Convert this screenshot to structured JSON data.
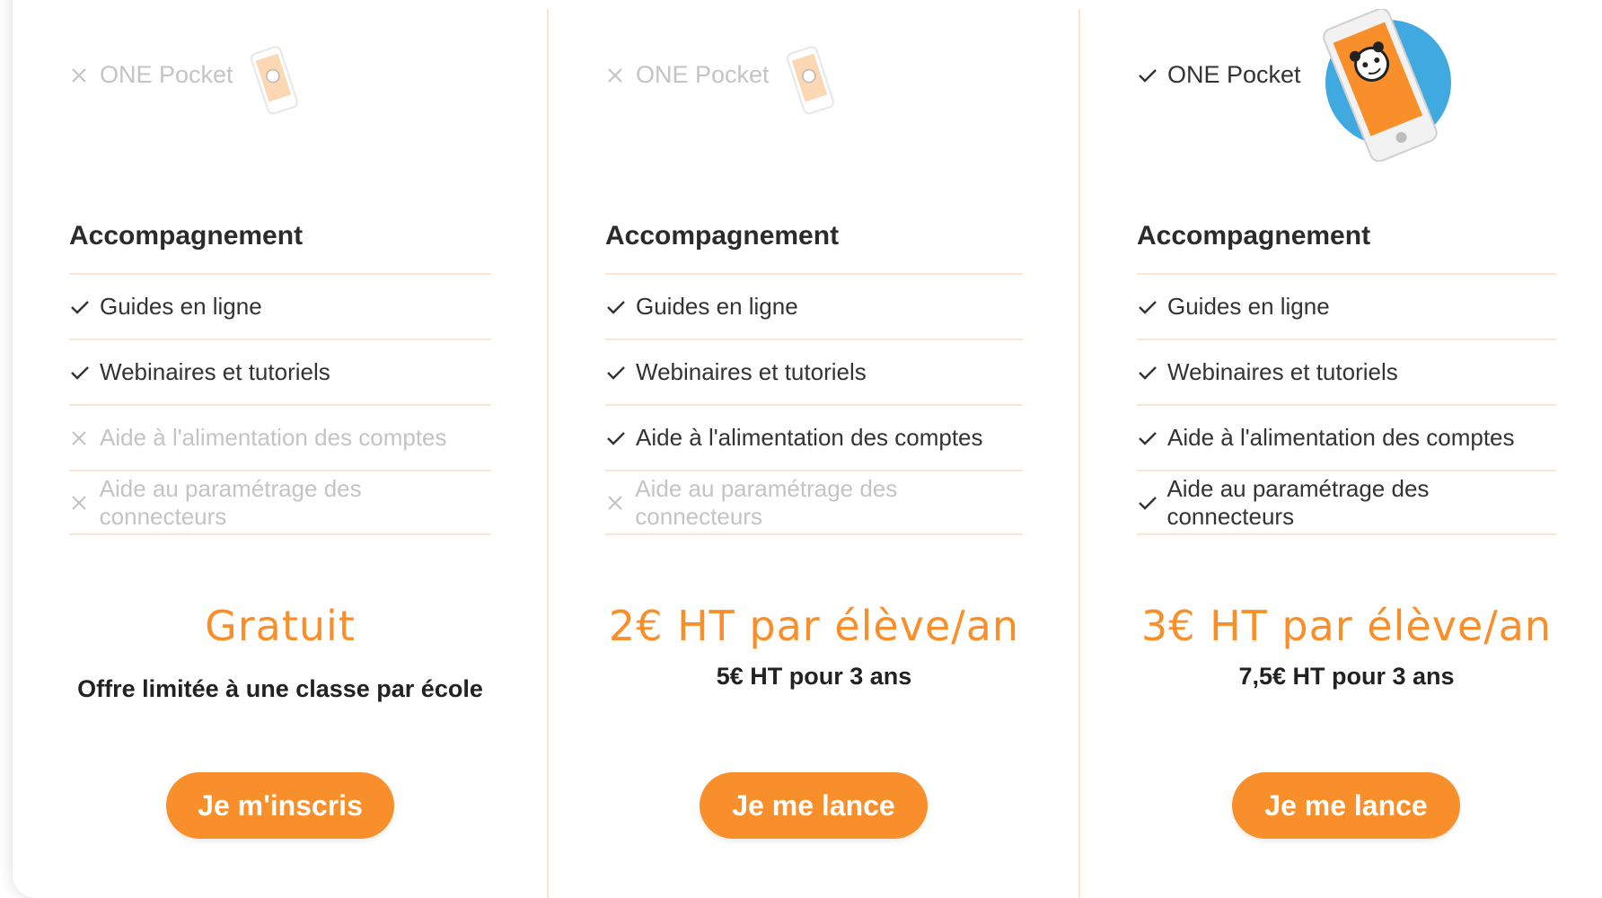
{
  "accent_color": "#f98f2a",
  "disabled_color": "#c4c4c4",
  "plans": [
    {
      "pocket": {
        "label": "ONE Pocket",
        "included": false
      },
      "section_title": "Accompagnement",
      "features": [
        {
          "label": "Guides en ligne",
          "included": true
        },
        {
          "label": "Webinaires et tutoriels",
          "included": true
        },
        {
          "label": "Aide à l'alimentation des comptes",
          "included": false
        },
        {
          "label": "Aide au paramétrage des connecteurs",
          "included": false
        }
      ],
      "price": "Gratuit",
      "price_note": "Offre limitée à une classe par école",
      "cta": "Je m'inscris"
    },
    {
      "pocket": {
        "label": "ONE Pocket",
        "included": false
      },
      "section_title": "Accompagnement",
      "features": [
        {
          "label": "Guides en ligne",
          "included": true
        },
        {
          "label": "Webinaires et tutoriels",
          "included": true
        },
        {
          "label": "Aide à l'alimentation des comptes",
          "included": true
        },
        {
          "label": "Aide au paramétrage des connecteurs",
          "included": false
        }
      ],
      "price": "2€ HT par élève/an",
      "price_note": "5€ HT pour 3 ans",
      "cta": "Je me lance"
    },
    {
      "pocket": {
        "label": "ONE Pocket",
        "included": true
      },
      "section_title": "Accompagnement",
      "features": [
        {
          "label": "Guides en ligne",
          "included": true
        },
        {
          "label": "Webinaires et tutoriels",
          "included": true
        },
        {
          "label": "Aide à l'alimentation des comptes",
          "included": true
        },
        {
          "label": "Aide au paramétrage des connecteurs",
          "included": true
        }
      ],
      "price": "3€ HT par élève/an",
      "price_note": "7,5€ HT pour 3 ans",
      "cta": "Je me lance"
    }
  ]
}
